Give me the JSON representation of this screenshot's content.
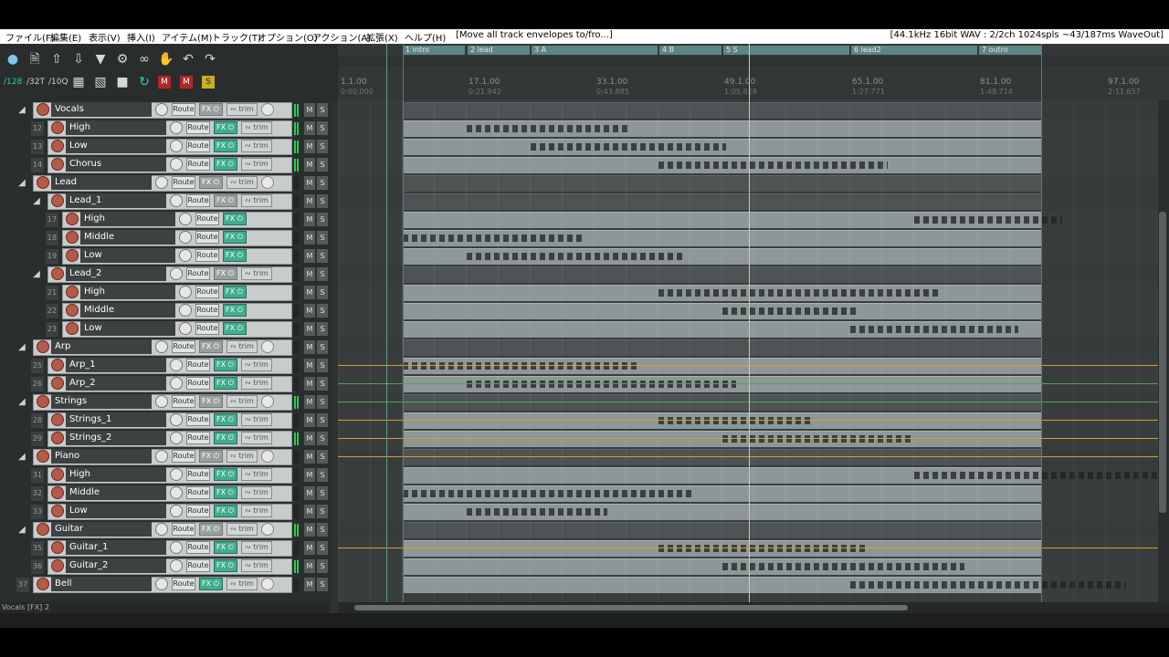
{
  "menu": {
    "items": [
      "ファイル(F)",
      "編集(E)",
      "表示(V)",
      "挿入(I)",
      "アイテム(M)",
      "トラック(T)",
      "オプション(O)",
      "アクション(A)",
      "拡張(X)",
      "ヘルプ(H)"
    ],
    "action_hint": "[Move all track envelopes to/fro...]",
    "audio_status": "[44.1kHz 16bit WAV : 2/2ch 1024spls ~43/187ms WaveOut]"
  },
  "toolbar": {
    "grid_labels": [
      "/128",
      "/32T",
      "/10Q"
    ]
  },
  "regions": [
    {
      "label": "1 intro"
    },
    {
      "label": "2 lead"
    },
    {
      "label": "3 A"
    },
    {
      "label": "4 B"
    },
    {
      "label": "5 S"
    },
    {
      "label": "6 lead2"
    },
    {
      "label": "7 outro"
    }
  ],
  "ruler": {
    "bars": [
      {
        "bar": "1.1.00",
        "time": "0:00.000"
      },
      {
        "bar": "17.1.00",
        "time": "0:21.942"
      },
      {
        "bar": "33.1.00",
        "time": "0:43.885"
      },
      {
        "bar": "49.1.00",
        "time": "1:05.828"
      },
      {
        "bar": "65.1.00",
        "time": "1:27.771"
      },
      {
        "bar": "81.1.00",
        "time": "1:49.714"
      },
      {
        "bar": "97.1.00",
        "time": "2:11.657"
      }
    ]
  },
  "tracks": [
    {
      "num": "",
      "name": "Vocals",
      "folder": true,
      "indent": 0,
      "meter": true
    },
    {
      "num": "12",
      "name": "High",
      "indent": 1,
      "meter": true
    },
    {
      "num": "13",
      "name": "Low",
      "indent": 1,
      "meter": true
    },
    {
      "num": "14",
      "name": "Chorus",
      "indent": 1,
      "meter": true
    },
    {
      "num": "",
      "name": "Lead",
      "folder": true,
      "indent": 0
    },
    {
      "num": "",
      "name": "Lead_1",
      "folder": true,
      "indent": 1
    },
    {
      "num": "17",
      "name": "High",
      "indent": 2
    },
    {
      "num": "18",
      "name": "Middle",
      "indent": 2
    },
    {
      "num": "19",
      "name": "Low",
      "indent": 2
    },
    {
      "num": "",
      "name": "Lead_2",
      "folder": true,
      "indent": 1
    },
    {
      "num": "21",
      "name": "High",
      "indent": 2
    },
    {
      "num": "22",
      "name": "Middle",
      "indent": 2
    },
    {
      "num": "23",
      "name": "Low",
      "indent": 2
    },
    {
      "num": "",
      "name": "Arp",
      "folder": true,
      "indent": 0
    },
    {
      "num": "25",
      "name": "Arp_1",
      "indent": 1
    },
    {
      "num": "26",
      "name": "Arp_2",
      "indent": 1
    },
    {
      "num": "",
      "name": "Strings",
      "folder": true,
      "indent": 0,
      "meter": true
    },
    {
      "num": "28",
      "name": "Strings_1",
      "indent": 1
    },
    {
      "num": "29",
      "name": "Strings_2",
      "indent": 1,
      "meter": true
    },
    {
      "num": "",
      "name": "Piano",
      "folder": true,
      "indent": 0
    },
    {
      "num": "31",
      "name": "High",
      "indent": 1
    },
    {
      "num": "32",
      "name": "Middle",
      "indent": 1
    },
    {
      "num": "33",
      "name": "Low",
      "indent": 1
    },
    {
      "num": "",
      "name": "Guitar",
      "folder": true,
      "indent": 0,
      "meter": true
    },
    {
      "num": "35",
      "name": "Guitar_1",
      "indent": 1
    },
    {
      "num": "36",
      "name": "Guitar_2",
      "indent": 1,
      "meter": true
    },
    {
      "num": "37",
      "name": "Bell",
      "indent": 0
    }
  ],
  "button_labels": {
    "route": "Route",
    "fx": "FX",
    "trim": "trim",
    "mute": "M",
    "solo": "S"
  },
  "status_left": "Vocals [FX] 2"
}
